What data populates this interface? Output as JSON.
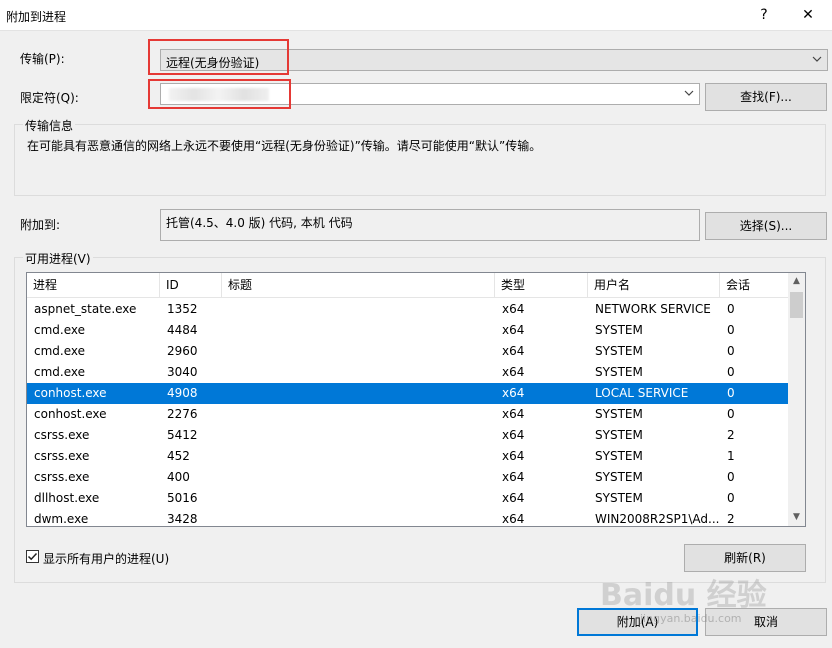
{
  "window": {
    "title": "附加到进程",
    "help_glyph": "?",
    "close_glyph": "✕"
  },
  "transport": {
    "label": "传输(P):",
    "value": "远程(无身份验证)"
  },
  "qualifier": {
    "label": "限定符(Q):",
    "value": "",
    "find_button": "查找(F)..."
  },
  "transport_info": {
    "title": "传输信息",
    "text": "在可能具有恶意通信的网络上永远不要使用“远程(无身份验证)”传输。请尽可能使用“默认”传输。"
  },
  "attach_to": {
    "label": "附加到:",
    "value": "托管(4.5、4.0 版) 代码, 本机 代码",
    "select_button": "选择(S)..."
  },
  "processes": {
    "title": "可用进程(V)",
    "columns": [
      "进程",
      "ID",
      "标题",
      "类型",
      "用户名",
      "会话"
    ],
    "rows": [
      {
        "process": "aspnet_state.exe",
        "id": "1352",
        "title": "",
        "type": "x64",
        "user": "NETWORK SERVICE",
        "session": "0",
        "selected": false
      },
      {
        "process": "cmd.exe",
        "id": "4484",
        "title": "",
        "type": "x64",
        "user": "SYSTEM",
        "session": "0",
        "selected": false
      },
      {
        "process": "cmd.exe",
        "id": "2960",
        "title": "",
        "type": "x64",
        "user": "SYSTEM",
        "session": "0",
        "selected": false
      },
      {
        "process": "cmd.exe",
        "id": "3040",
        "title": "",
        "type": "x64",
        "user": "SYSTEM",
        "session": "0",
        "selected": false
      },
      {
        "process": "conhost.exe",
        "id": "4908",
        "title": "",
        "type": "x64",
        "user": "LOCAL SERVICE",
        "session": "0",
        "selected": true
      },
      {
        "process": "conhost.exe",
        "id": "2276",
        "title": "",
        "type": "x64",
        "user": "SYSTEM",
        "session": "0",
        "selected": false
      },
      {
        "process": "csrss.exe",
        "id": "5412",
        "title": "",
        "type": "x64",
        "user": "SYSTEM",
        "session": "2",
        "selected": false
      },
      {
        "process": "csrss.exe",
        "id": "452",
        "title": "",
        "type": "x64",
        "user": "SYSTEM",
        "session": "1",
        "selected": false
      },
      {
        "process": "csrss.exe",
        "id": "400",
        "title": "",
        "type": "x64",
        "user": "SYSTEM",
        "session": "0",
        "selected": false
      },
      {
        "process": "dllhost.exe",
        "id": "5016",
        "title": "",
        "type": "x64",
        "user": "SYSTEM",
        "session": "0",
        "selected": false
      },
      {
        "process": "dwm.exe",
        "id": "3428",
        "title": "",
        "type": "x64",
        "user": "WIN2008R2SP1\\Ad...",
        "session": "2",
        "selected": false
      }
    ]
  },
  "show_all_users": {
    "label": "显示所有用户的进程(U)",
    "checked": true
  },
  "refresh_button": "刷新(R)",
  "attach_button": "附加(A)",
  "cancel_button": "取消",
  "watermark": {
    "logo": "Baidu 经验",
    "url": "jingyan.baidu.com"
  },
  "colors": {
    "selection": "#0078d7",
    "highlight_box": "#e53935",
    "dialog_bg": "#f0f0f0"
  }
}
